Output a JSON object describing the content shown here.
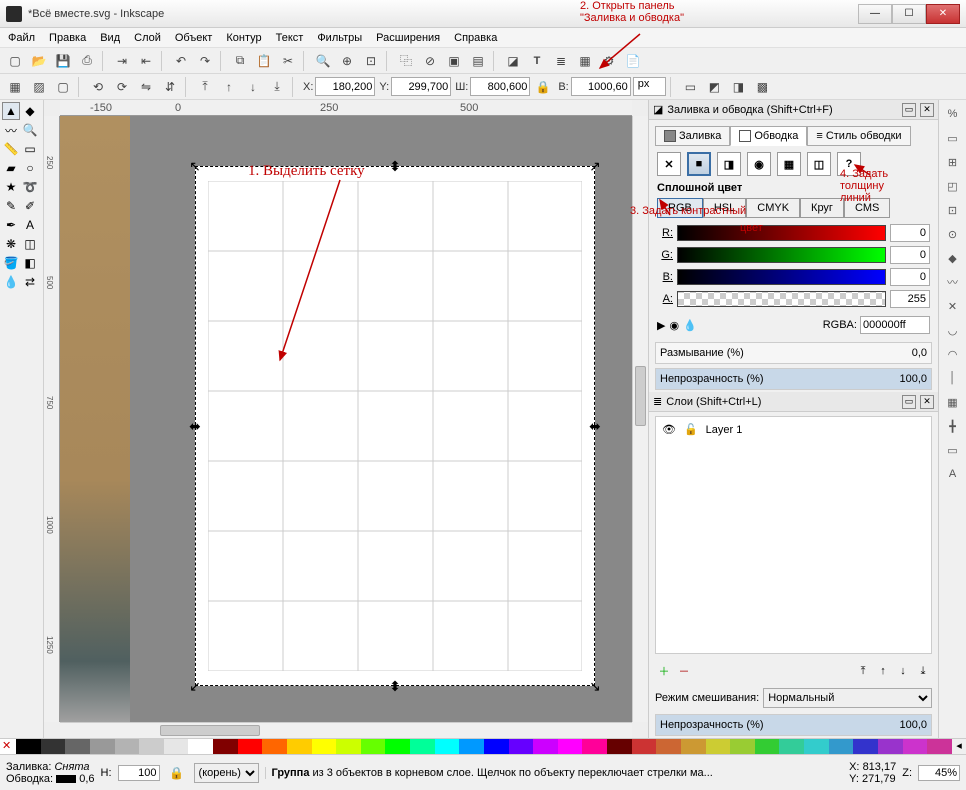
{
  "window": {
    "title": "*Всё вместе.svg - Inkscape"
  },
  "menu": [
    "Файл",
    "Правка",
    "Вид",
    "Слой",
    "Объект",
    "Контур",
    "Текст",
    "Фильтры",
    "Расширения",
    "Справка"
  ],
  "coords": {
    "x_label": "X:",
    "x": "180,200",
    "y_label": "Y:",
    "y": "299,700",
    "w_label": "Ш:",
    "w": "800,600",
    "h_label": "В:",
    "h": "1000,60",
    "unit": "px"
  },
  "ruler_h": {
    "m150": "-150",
    "p0": "0",
    "p250": "250",
    "p500": "500"
  },
  "ruler_v": {
    "a": "250",
    "b": "500",
    "c": "750",
    "d": "1000",
    "e": "1250"
  },
  "fillstroke": {
    "title": "Заливка и обводка (Shift+Ctrl+F)",
    "tabs": {
      "fill": "Заливка",
      "stroke": "Обводка",
      "style": "Стиль обводки"
    },
    "flat": "Сплошной цвет",
    "modes": {
      "rgb": "RGB",
      "hsl": "HSL",
      "cmyk": "CMYK",
      "wheel": "Круг",
      "cms": "CMS"
    },
    "r_label": "R:",
    "r_val": "0",
    "g_label": "G:",
    "g_val": "0",
    "b_label": "B:",
    "b_val": "0",
    "a_label": "A:",
    "a_val": "255",
    "rgba_label": "RGBA:",
    "rgba_val": "000000ff",
    "blur_label": "Размывание (%)",
    "blur_val": "0,0",
    "opacity_label": "Непрозрачность (%)",
    "opacity_val": "100,0"
  },
  "layers": {
    "title": "Слои (Shift+Ctrl+L)",
    "layer1": "Layer 1",
    "blend_label": "Режим смешивания:",
    "blend_val": "Нормальный",
    "op_label": "Непрозрачность (%)",
    "op_val": "100,0"
  },
  "status": {
    "fill_label": "Заливка:",
    "fill_val": "Снята",
    "stroke_label": "Обводка:",
    "stroke_opacity": "0,6",
    "h_label": "Н:",
    "h_val": "100",
    "layer_sel": "(корень)",
    "msg": "Группа из 3 объектов в корневом слое. Щелчок по объекту переключает стрелки ма...",
    "x_label": "X:",
    "x_val": "813,17",
    "y_label": "Y:",
    "y_val": "271,79",
    "z_label": "Z:",
    "z_val": "45%"
  },
  "anno": {
    "a1": "1. Выделить сетку",
    "a2_1": "2. Открыть панель",
    "a2_2": "\"Заливка и обводка\"",
    "a3_1": "3. Задать контрастный",
    "a3_2": "цвет",
    "a4_1": "4. Задать",
    "a4_2": "толщину",
    "a4_3": "линий"
  },
  "palette_colors": [
    "#000000",
    "#333333",
    "#666666",
    "#999999",
    "#b3b3b3",
    "#cccccc",
    "#e6e6e6",
    "#ffffff",
    "#800000",
    "#ff0000",
    "#ff6600",
    "#ffcc00",
    "#ffff00",
    "#ccff00",
    "#66ff00",
    "#00ff00",
    "#00ff99",
    "#00ffff",
    "#0099ff",
    "#0000ff",
    "#6600ff",
    "#cc00ff",
    "#ff00ff",
    "#ff0099",
    "#660000",
    "#cc3333",
    "#cc6633",
    "#cc9933",
    "#cccc33",
    "#99cc33",
    "#33cc33",
    "#33cc99",
    "#33cccc",
    "#3399cc",
    "#3333cc",
    "#9933cc",
    "#cc33cc",
    "#cc3399"
  ]
}
